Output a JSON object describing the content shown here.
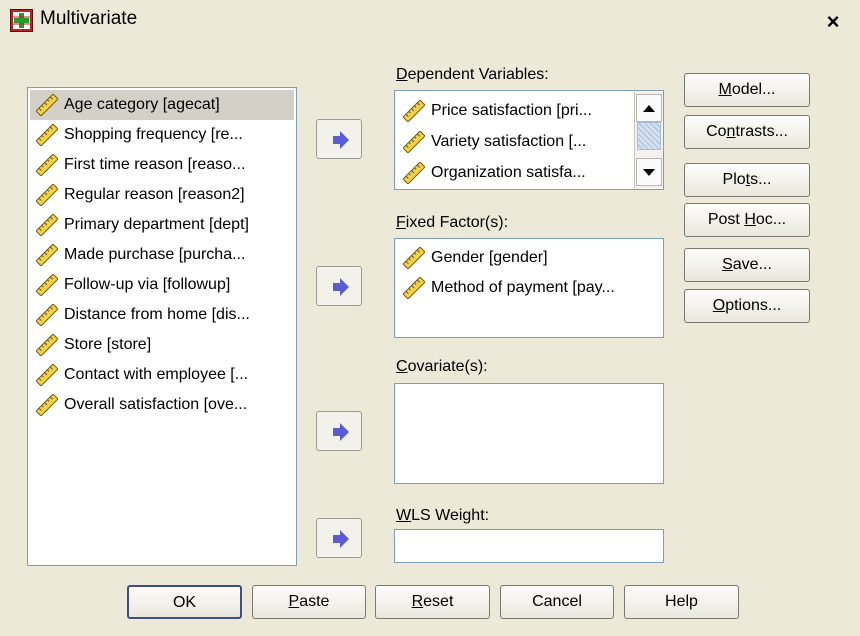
{
  "window": {
    "title": "Multivariate",
    "close_symbol": "×",
    "icon": "spss-dialog-icon"
  },
  "source_list": {
    "items": [
      {
        "label": "Age category [agecat]",
        "selected": true
      },
      {
        "label": "Shopping frequency [re..."
      },
      {
        "label": "First time reason [reaso..."
      },
      {
        "label": "Regular reason [reason2]"
      },
      {
        "label": "Primary department [dept]"
      },
      {
        "label": "Made purchase [purcha..."
      },
      {
        "label": "Follow-up via [followup]"
      },
      {
        "label": "Distance from home [dis..."
      },
      {
        "label": "Store [store]"
      },
      {
        "label": "Contact with employee [..."
      },
      {
        "label": "Overall satisfaction [ove..."
      }
    ],
    "item_icon": "ruler-icon"
  },
  "dependent": {
    "label_pre": "",
    "label_key": "D",
    "label_post": "ependent Variables:",
    "items": [
      {
        "label": "Price satisfaction [pri..."
      },
      {
        "label": "Variety satisfaction [..."
      },
      {
        "label": "Organization satisfa..."
      }
    ]
  },
  "fixed": {
    "label_pre": "",
    "label_key": "F",
    "label_post": "ixed Factor(s):",
    "items": [
      {
        "label": "Gender [gender]"
      },
      {
        "label": "Method of payment [pay..."
      }
    ]
  },
  "covariate": {
    "label_pre": "",
    "label_key": "C",
    "label_post": "ovariate(s):"
  },
  "wls": {
    "label_pre": "",
    "label_key": "W",
    "label_post": "LS Weight:",
    "value": ""
  },
  "side_buttons": [
    {
      "pre": "",
      "key": "M",
      "post": "odel..."
    },
    {
      "pre": "Co",
      "key": "n",
      "post": "trasts..."
    },
    {
      "pre": "Plo",
      "key": "t",
      "post": "s..."
    },
    {
      "pre": "Post ",
      "key": "H",
      "post": "oc..."
    },
    {
      "pre": "",
      "key": "S",
      "post": "ave..."
    },
    {
      "pre": "",
      "key": "O",
      "post": "ptions..."
    }
  ],
  "bottom_buttons": [
    {
      "pre": "OK",
      "key": "",
      "post": ""
    },
    {
      "pre": "",
      "key": "P",
      "post": "aste"
    },
    {
      "pre": "",
      "key": "R",
      "post": "eset"
    },
    {
      "pre": "Cancel",
      "key": "",
      "post": ""
    },
    {
      "pre": "Help",
      "key": "",
      "post": ""
    }
  ],
  "colors": {
    "dialog_bg": "#ece9d8",
    "arrow": "#5b5bd6",
    "list_border": "#7f9db9",
    "selected_bg": "#d4d0c8"
  }
}
